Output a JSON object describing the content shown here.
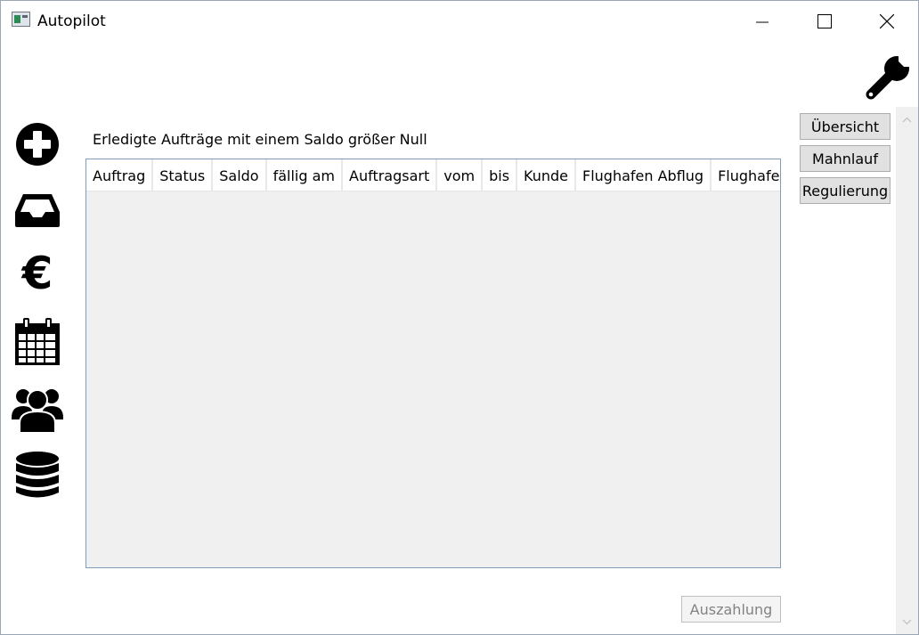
{
  "window": {
    "title": "Autopilot"
  },
  "nav": {
    "items": [
      {
        "icon": "plus-circle-icon"
      },
      {
        "icon": "inbox-tray-icon"
      },
      {
        "icon": "euro-icon",
        "glyph": "€"
      },
      {
        "icon": "calendar-icon"
      },
      {
        "icon": "users-icon"
      },
      {
        "icon": "database-icon"
      }
    ]
  },
  "main": {
    "grid_title": "Erledigte Aufträge mit einem Saldo größer Null",
    "columns": [
      "Auftrag",
      "Status",
      "Saldo",
      "fällig am",
      "Auftragsart",
      "vom",
      "bis",
      "Kunde",
      "Flughafen Abflug",
      "Flughafen"
    ],
    "rows": []
  },
  "actions": {
    "overview": "Übersicht",
    "dunning": "Mahnlauf",
    "regulation": "Regulierung",
    "payout": "Auszahlung"
  },
  "colors": {
    "grid_background": "#f0f0f0",
    "grid_border": "#7f9db9",
    "button_background": "#e1e1e1",
    "disabled_text": "#838383"
  }
}
